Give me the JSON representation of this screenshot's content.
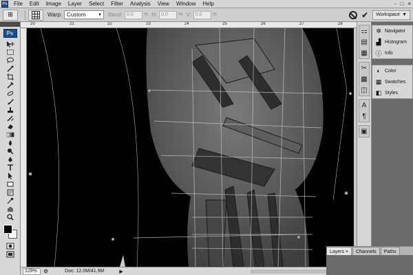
{
  "app": {
    "logo": "Ps"
  },
  "menubar": {
    "items": [
      "File",
      "Edit",
      "Image",
      "Layer",
      "Select",
      "Filter",
      "Analysis",
      "View",
      "Window",
      "Help"
    ],
    "win_buttons": [
      "-",
      "□",
      "×"
    ]
  },
  "options": {
    "warp_label": "Warp:",
    "warp_value": "Custom",
    "bend_label": "Bend:",
    "bend_value": "0.0",
    "h_label": "H:",
    "h_value": "0.0",
    "v_label": "V:",
    "v_value": "0.0",
    "pct": "%",
    "workspace_label": "Workspace"
  },
  "rulers": {
    "top_labels": [
      "20",
      "21",
      "22",
      "23",
      "24",
      "25",
      "26",
      "27",
      "28"
    ]
  },
  "status": {
    "zoom": "129%",
    "doc_info": "Doc: 12.0M/41.9M"
  },
  "panels": {
    "group1": [
      "Navigator",
      "Histogram",
      "Info"
    ],
    "group2": [
      "Color",
      "Swatches",
      "Styles"
    ]
  },
  "layers": {
    "tabs": [
      "Layers",
      "Channels",
      "Paths"
    ]
  },
  "colors": {
    "menu_bg": "#d6d6d6",
    "panel_bg": "#d8d8d8",
    "workspace_bg": "#6b6b6b",
    "canvas_bg": "#000000",
    "ps_blue": "#1c4f8c",
    "foreground_swatch": "#000000",
    "background_swatch": "#ffffff"
  }
}
